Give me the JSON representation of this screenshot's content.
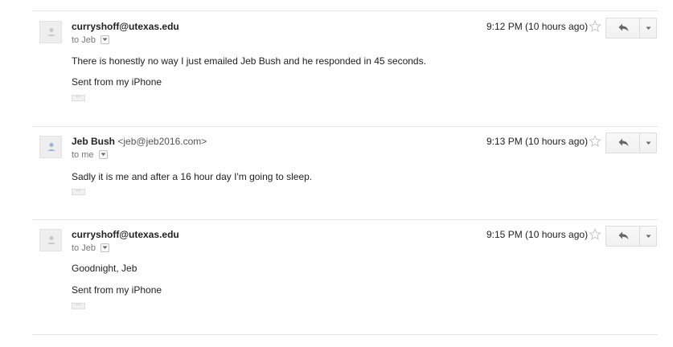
{
  "messages": [
    {
      "sender_name": "curryshoff@utexas.edu",
      "sender_email": "",
      "recipient": "to Jeb",
      "time": "9:12 PM (10 hours ago)",
      "body": [
        "There is honestly no way I just emailed Jeb Bush and he responded in 45 seconds.",
        "Sent from my iPhone"
      ],
      "trimmed_indicator": "···",
      "avatar_icon": "person-silhouette-icon",
      "avatar_color": "#c8c8c8"
    },
    {
      "sender_name": "Jeb Bush",
      "sender_email": "<jeb@jeb2016.com>",
      "recipient": "to me",
      "time": "9:13 PM (10 hours ago)",
      "body": [
        "Sadly it is me and after a 16 hour day I'm going to sleep."
      ],
      "trimmed_indicator": "···",
      "avatar_icon": "person-silhouette-icon",
      "avatar_color": "#9fb3d9"
    },
    {
      "sender_name": "curryshoff@utexas.edu",
      "sender_email": "",
      "recipient": "to Jeb",
      "time": "9:15 PM (10 hours ago)",
      "body": [
        "Goodnight, Jeb",
        "Sent from my iPhone"
      ],
      "trimmed_indicator": "···",
      "avatar_icon": "person-silhouette-icon",
      "avatar_color": "#c8c8c8"
    }
  ],
  "icons": {
    "star": "star-outline-icon",
    "reply": "reply-arrow-icon",
    "more": "dropdown-arrow-icon",
    "details": "chevron-down-icon"
  },
  "colors": {
    "divider": "#e5e5e5",
    "star_outline": "#c6c6c6",
    "icon_gray": "#666666"
  }
}
